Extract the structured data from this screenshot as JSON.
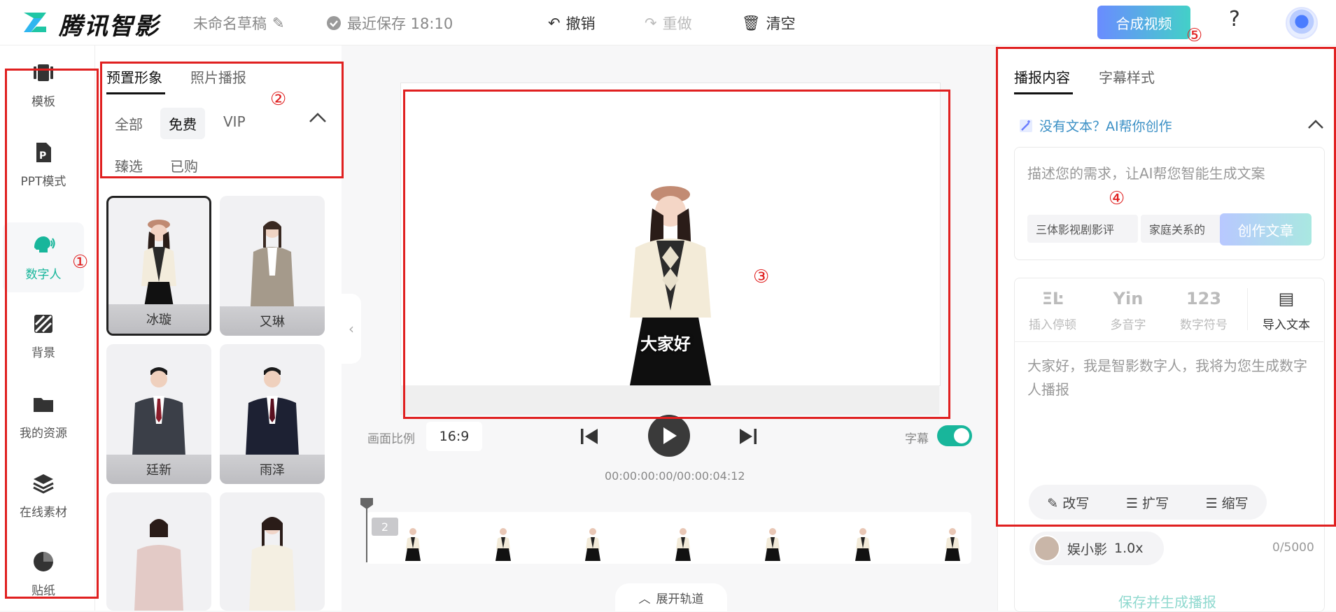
{
  "header": {
    "app_name": "腾讯智影",
    "draft_name": "未命名草稿",
    "save_status": "最近保存 18:10",
    "undo": "撤销",
    "redo": "重做",
    "clear": "清空",
    "compose": "合成视频",
    "help": "?"
  },
  "rail": {
    "items": [
      {
        "label": "模板",
        "icon": "template-icon"
      },
      {
        "label": "PPT模式",
        "icon": "ppt-icon"
      },
      {
        "label": "数字人",
        "icon": "digital-human-icon",
        "active": true
      },
      {
        "label": "背景",
        "icon": "background-icon"
      },
      {
        "label": "我的资源",
        "icon": "folder-icon"
      },
      {
        "label": "在线素材",
        "icon": "layers-icon"
      },
      {
        "label": "贴纸",
        "icon": "sticker-icon"
      }
    ]
  },
  "assets": {
    "tabs": [
      "预置形象",
      "照片播报"
    ],
    "filters": [
      "全部",
      "免费",
      "VIP"
    ],
    "filters2": [
      "臻选",
      "已购"
    ],
    "cards": [
      "冰璇",
      "又琳",
      "廷新",
      "雨泽"
    ]
  },
  "preview": {
    "caption": "大家好",
    "ratio_label": "画面比例",
    "ratio_value": "16:9",
    "subtitle_label": "字幕",
    "subtitle_on": true,
    "timecode": "00:00:00:00/00:00:04:12",
    "track_badge": "2",
    "expand_track": "展开轨道"
  },
  "right": {
    "tabs": [
      "播报内容",
      "字幕样式"
    ],
    "ai_title": "没有文本？AI帮你创作",
    "ai_placeholder": "描述您的需求，让AI帮您智能生成文案",
    "suggestions": [
      "三体影视剧影评",
      "家庭关系的"
    ],
    "create_btn": "创作文章",
    "tools": [
      "插入停顿",
      "多音字",
      "数字符号",
      "导入文本"
    ],
    "tool_glyphs": [
      "ΞĿ",
      "Yin",
      "123",
      "▤"
    ],
    "editor_text": "大家好，我是智影数字人，我将为您生成数字人播报",
    "rewrite": "改写",
    "expand": "扩写",
    "shorten": "缩写",
    "voice_name": "娱小影",
    "voice_speed": "1.0x",
    "char_count": "0/5000",
    "save_generate": "保存并生成播报"
  },
  "annotations": [
    "①",
    "②",
    "③",
    "④",
    "⑤"
  ],
  "colors": {
    "accent": "#18b69b",
    "annotation": "#e02020"
  }
}
